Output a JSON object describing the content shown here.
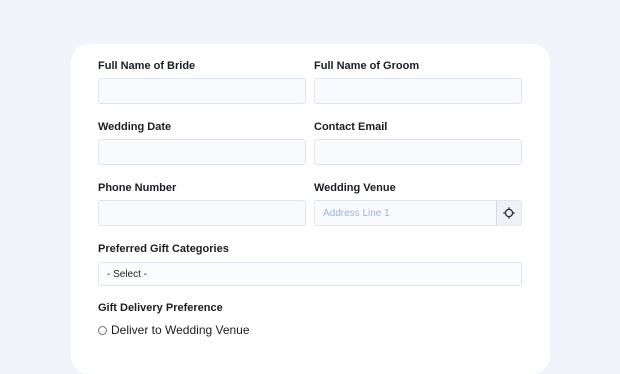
{
  "form": {
    "bride_name": {
      "label": "Full Name of Bride",
      "value": "",
      "placeholder": ""
    },
    "groom_name": {
      "label": "Full Name of Groom",
      "value": "",
      "placeholder": ""
    },
    "wedding_date": {
      "label": "Wedding Date",
      "value": "",
      "placeholder": ""
    },
    "contact_email": {
      "label": "Contact Email",
      "value": "",
      "placeholder": ""
    },
    "phone_number": {
      "label": "Phone Number",
      "value": "",
      "placeholder": ""
    },
    "wedding_venue": {
      "label": "Wedding Venue",
      "value": "",
      "placeholder": "Address Line 1",
      "button_icon": "crosshair-icon"
    },
    "gift_categories": {
      "label": "Preferred Gift Categories",
      "selected": "- Select -"
    },
    "delivery_preference": {
      "label": "Gift Delivery Preference",
      "options": [
        {
          "label": "Deliver to Wedding Venue",
          "checked": false
        }
      ]
    }
  },
  "colors": {
    "page_background": "#f1f4fb",
    "card_background": "#ffffff",
    "field_border": "#dfe6f0",
    "placeholder_text": "#9db4d8"
  }
}
